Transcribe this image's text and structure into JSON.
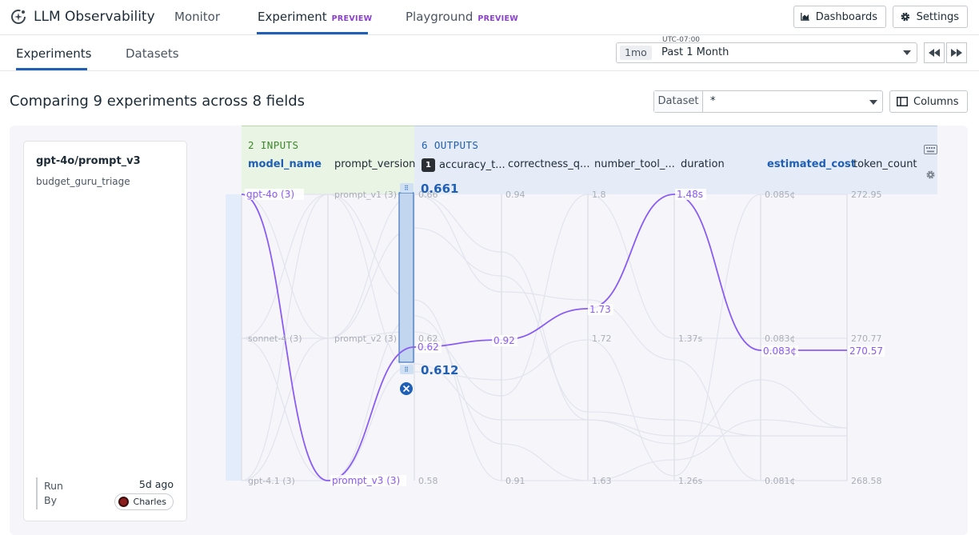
{
  "brand": {
    "title": "LLM Observability"
  },
  "nav": {
    "items": [
      {
        "label": "Monitor",
        "badge": ""
      },
      {
        "label": "Experiment",
        "badge": "PREVIEW"
      },
      {
        "label": "Playground",
        "badge": "PREVIEW"
      }
    ],
    "dashboards_label": "Dashboards",
    "settings_label": "Settings"
  },
  "subnav": {
    "tabs": [
      "Experiments",
      "Datasets"
    ],
    "timezone": "UTC-07:00",
    "time_chip": "1mo",
    "time_label": "Past 1 Month"
  },
  "heading": "Comparing 9 experiments across 8 fields",
  "dataset_filter": {
    "label": "Dataset",
    "value": "*"
  },
  "columns_label": "Columns",
  "card": {
    "title": "gpt-4o/prompt_v3",
    "subtitle": "budget_guru_triage",
    "run_label": "Run",
    "by_label": "By",
    "ago": "5d  ago",
    "user": "Charles"
  },
  "groups": {
    "inputs": "2 INPUTS",
    "outputs": "6 OUTPUTS"
  },
  "columns": [
    {
      "name": "model_name",
      "sorted": true
    },
    {
      "name": "prompt_version",
      "sorted": false
    },
    {
      "name": "accuracy_t...",
      "sorted": false,
      "rank": "1"
    },
    {
      "name": "correctness_q...",
      "sorted": false
    },
    {
      "name": "number_tool_...",
      "sorted": false
    },
    {
      "name": "duration",
      "sorted": false
    },
    {
      "name": "estimated_cost",
      "sorted": true
    },
    {
      "name": "token_count",
      "sorted": false
    }
  ],
  "axes": {
    "model_name": {
      "ticks": [
        "gpt-4o",
        "sonnet-4",
        "gpt-4.1"
      ],
      "counts": [
        "(3)",
        "(3)",
        "(3)"
      ]
    },
    "prompt_version": {
      "ticks": [
        "prompt_v1",
        "prompt_v2",
        "prompt_v3"
      ],
      "counts": [
        "(3)",
        "(3)",
        "(3)"
      ]
    },
    "accuracy": {
      "ticks": [
        "0.66",
        "0.62",
        "0.58"
      ]
    },
    "correctness": {
      "ticks": [
        "0.94",
        "0.91"
      ]
    },
    "number_tool": {
      "ticks": [
        "1.8",
        "1.72",
        "1.63"
      ]
    },
    "duration": {
      "ticks": [
        "1.48s",
        "1.37s",
        "1.26s"
      ]
    },
    "estimated_cost": {
      "ticks": [
        "0.085¢",
        "0.083¢",
        "0.081¢"
      ]
    },
    "token_count": {
      "ticks": [
        "272.95",
        "270.77",
        "268.58"
      ]
    }
  },
  "brush": {
    "upper": "0.661",
    "lower": "0.612"
  },
  "selected_path": {
    "model_name": "gpt-4o",
    "prompt_version": "prompt_v3",
    "accuracy": "0.62",
    "correctness": "0.92",
    "number_tool": "1.73",
    "duration": "1.48s",
    "estimated_cost": "0.083¢",
    "token_count": "270.57"
  },
  "colors": {
    "accent": "#1f5fb5",
    "highlight": "#8a5cf5",
    "inputs_band": "#eaf4e5",
    "outputs_band": "#e5ecf8",
    "badge": "#8a3fd1"
  }
}
